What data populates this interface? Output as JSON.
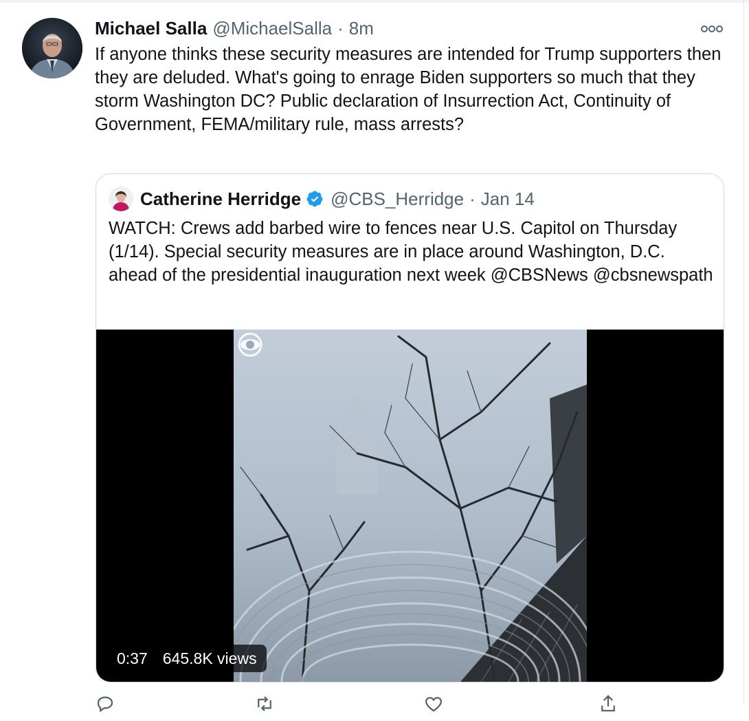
{
  "tweet": {
    "author_name": "Michael Salla",
    "author_handle": "@MichaelSalla",
    "separator": "·",
    "time": "8m",
    "text": "If anyone thinks these security measures are intended for Trump supporters then they are deluded. What's going to enrage Biden supporters so much that they storm Washington DC? Public declaration of Insurrection Act, Continuity of Government, FEMA/military rule, mass arrests?",
    "more_icon": "more-horizontal-icon"
  },
  "quote": {
    "author_name": "Catherine Herridge",
    "verified_icon": "verified-badge-icon",
    "author_handle": "@CBS_Herridge",
    "separator": "·",
    "date": "Jan 14",
    "text": "WATCH: Crews add barbed wire to fences near U.S. Capitol on Thursday (1/14). Special security measures are in place around Washington, D.C. ahead of the presidential inauguration next week @CBSNews @cbsnewspath",
    "video": {
      "duration": "0:37",
      "views": "645.8K views",
      "watermark_icon": "cbs-eye-logo"
    }
  },
  "actions": {
    "reply_icon": "reply-icon",
    "retweet_icon": "retweet-icon",
    "like_icon": "like-icon",
    "share_icon": "share-icon"
  },
  "colors": {
    "text_primary": "#0f1419",
    "text_secondary": "#536471",
    "border": "#cfd9de",
    "verified_blue": "#1d9bf0",
    "video_bg": "#000000"
  }
}
